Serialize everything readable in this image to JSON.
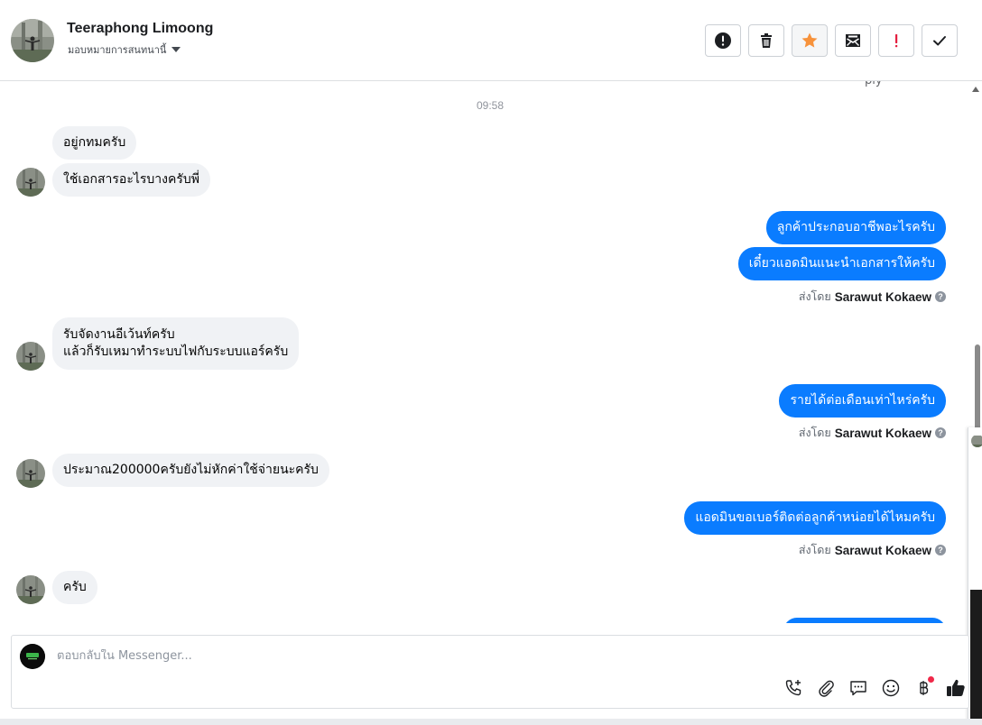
{
  "header": {
    "contact_name": "Teeraphong Limoong",
    "assignment_label": "มอบหมายการสนทนานี้",
    "toolbar": [
      {
        "name": "mark-spam-button",
        "icon": "alert-circle-icon"
      },
      {
        "name": "delete-button",
        "icon": "trash-icon"
      },
      {
        "name": "star-button",
        "icon": "star-icon"
      },
      {
        "name": "mark-unread-button",
        "icon": "envelope-icon"
      },
      {
        "name": "follow-up-button",
        "icon": "exclamation-icon"
      },
      {
        "name": "mark-done-button",
        "icon": "checkmark-icon"
      }
    ]
  },
  "thread": {
    "truncated_top_text": "ply",
    "timestamp": "09:58",
    "messages": [
      {
        "dir": "in",
        "text": "อยู่กทมครับ"
      },
      {
        "dir": "in",
        "text": "ใช้เอกสารอะไรบางครับพี่"
      },
      {
        "dir": "out",
        "text": "ลูกค้าประกอบอาชีพอะไรครับ"
      },
      {
        "dir": "out",
        "text": "เดี๋ยวแอดมินแนะนำเอกสารให้ครับ"
      },
      {
        "dir": "in",
        "line1": "รับจัดงานอีเว้นท์ครับ",
        "line2": "แล้วก็รับเหมาทำระบบไฟกับระบบแอร์ครับ"
      },
      {
        "dir": "out",
        "text": "รายได้ต่อเดือนเท่าไหร่ครับ"
      },
      {
        "dir": "in",
        "text": "ประมาณ200000ครับยังไม่หักค่าใช้จ่ายนะครับ"
      },
      {
        "dir": "out",
        "text": "แอดมินขอเบอร์ติดต่อลูกค้าหน่อยได้ไหมครับ"
      },
      {
        "dir": "in",
        "text": "ครับ"
      }
    ],
    "sent_by_prefix": "ส่งโดย",
    "sent_by_name": "Sarawut Kokaew",
    "help_glyph": "?"
  },
  "composer": {
    "placeholder": "ตอบกลับใน Messenger...",
    "tools": [
      "call-icon",
      "attachment-icon",
      "saved-reply-icon",
      "emoji-icon",
      "baht-payment-icon",
      "like-icon"
    ]
  },
  "colors": {
    "outgoing_bubble": "#0a7cff",
    "incoming_bubble": "#f0f2f5",
    "star_accent": "#f7923b",
    "follow_up_red": "#e41e3f",
    "notification_dot": "#f02849"
  }
}
